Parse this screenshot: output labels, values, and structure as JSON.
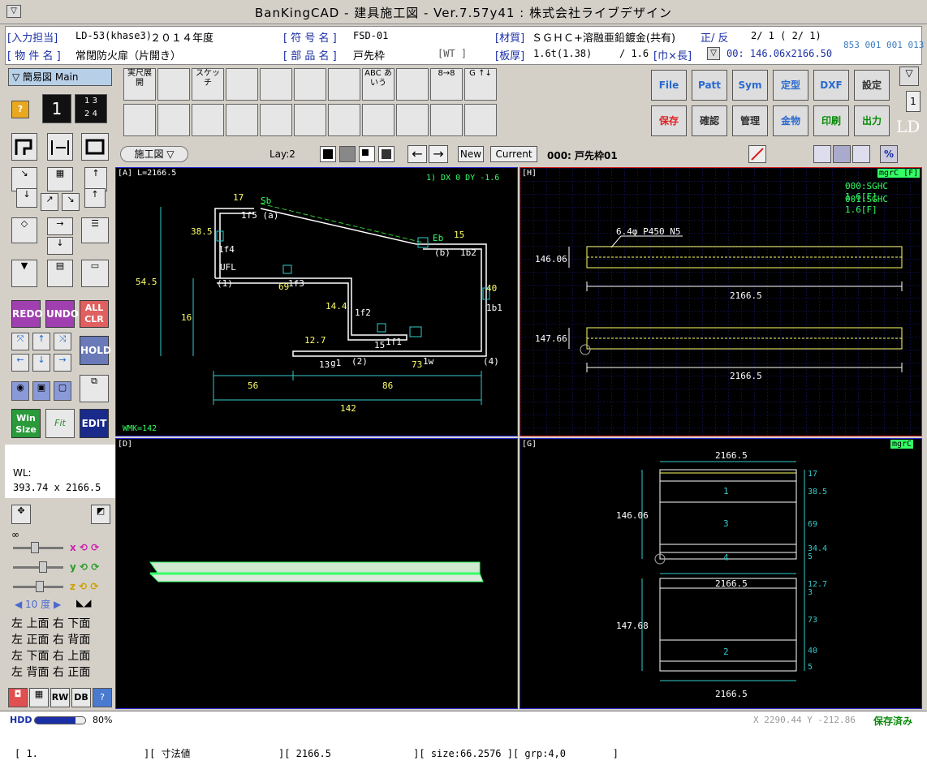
{
  "app": {
    "title": "BanKingCAD - 建具施工図 - Ver.7.57y41 : 株式会社ライブデザイン"
  },
  "info": {
    "nyuryoku_label": "[入力担当]",
    "nyuryoku_value": "LD-53(khase3)",
    "year": "２０１４年度",
    "fugo_label": "[ 符 号 名 ]",
    "fugo_value": "FSD-01",
    "zaishitsu_label": "[材質]",
    "zaishitsu_value": "ＳＧＨＣ+溶融亜鉛鍍金(共有)",
    "seihan": "正/ 反",
    "page": "2/ 1 ( 2/ 1)",
    "codes": "853 001 001 013",
    "bukken_label": "[ 物 件 名 ]",
    "bukken_value": "常閉防火扉（片開き）",
    "buhin_label": "[ 部 品 名 ]",
    "buhin_value": "戸先枠",
    "wt": "[WT  ]",
    "itaatsu_label": "[板厚]",
    "itaatsu_value": "1.6t(1.38)",
    "itaatsu2": "/ 1.6",
    "haba_label": "[巾×長]",
    "haba_value": "00: 146.06x2166.50"
  },
  "left": {
    "mode": "簡易図 Main",
    "num": "1",
    "grid": [
      "1",
      "3",
      "2",
      "4"
    ],
    "redo": "REDO",
    "undo": "UNDO",
    "allclr": "ALL CLR",
    "hold": "HOLD",
    "win": "Win Size",
    "edit": "EDIT",
    "wl_label": "WL:",
    "wl_value": "393.74 x 2166.5",
    "inf": "∞",
    "deg": "10 度",
    "views": [
      [
        "左",
        "上面",
        "右",
        "下面"
      ],
      [
        "左",
        "正面",
        "右",
        "背面"
      ],
      [
        "左",
        "下面",
        "右",
        "上面"
      ],
      [
        "左",
        "背面",
        "右",
        "正面"
      ]
    ],
    "bottom": [
      "RW",
      "DB"
    ]
  },
  "toolbar": {
    "tools": [
      "実尺展開",
      "",
      "スケッチ",
      "",
      "",
      "",
      "",
      "ABC あいう",
      "",
      "8→8",
      "G ↑↓",
      "",
      "",
      "",
      "",
      "",
      "",
      "",
      "",
      "",
      "",
      ""
    ],
    "file_buttons": [
      "File",
      "Patt",
      "Sym",
      "定型",
      "DXF",
      "設定",
      "保存",
      "確認",
      "管理",
      "金物",
      "印刷",
      "出力"
    ],
    "ld": "LD",
    "side_num": "1"
  },
  "toolbar2": {
    "view": "施工図 ▽",
    "lay": "Lay:2",
    "new": "New",
    "current": "Current",
    "part": "000: 戸先枠01"
  },
  "paneA": {
    "label": "[A]  L=2166.5",
    "dx": "1) DX    0 DY -1.6",
    "wmk": "WMK=142",
    "dims": [
      "17",
      "38.5",
      "15",
      "54.5",
      "16",
      "14.4",
      "12.7",
      "40",
      "73",
      "56",
      "86",
      "142",
      "69"
    ],
    "marks": [
      "Sb",
      "Eb",
      "1f5 (a)",
      "1f4",
      "(b)",
      "1b2",
      "UFL",
      "(1)",
      "1f3",
      "1f2",
      "1f1",
      "1b1",
      "(2)",
      "(4)",
      "1w",
      "g1",
      "15",
      "13"
    ]
  },
  "paneH": {
    "label": "[H]",
    "badge": "mgrC [F]",
    "line1": "000:SGHC 1.6[F]",
    "line2": "001:SGHC 1.6[F]",
    "d1": "146.06",
    "d2": "147.66",
    "len1": "2166.5",
    "len2": "2166.5",
    "hole": "6.4φ P450 N5"
  },
  "paneD": {
    "label": "[D]"
  },
  "paneG": {
    "label": "[G]",
    "badge": "mgrC",
    "top": "2166.5",
    "mid": "2166.5",
    "bot": "2166.5",
    "h1": "146.06",
    "h2": "147.68",
    "n1": "1",
    "n3": "3",
    "n4": "4",
    "n2": "2",
    "r": [
      "17",
      "38.5",
      "69",
      "34.4",
      "5",
      "12.7",
      "3",
      "73",
      "40",
      "5"
    ]
  },
  "status": {
    "hdd": "HDD",
    "pct": "80%",
    "coords": "X 2290.44 Y -212.86",
    "saved": "保存済み"
  },
  "bottom": "[ 1.                  ][ 寸法値               ][ 2166.5              ][ size:66.2576 ][ grp:4,0        ]",
  "colors": {
    "accent": "#1a2ea6",
    "cad_yellow": "#ffff66",
    "cad_cyan": "#33cccc",
    "cad_green": "#33ff66",
    "saved": "#0a8a0a"
  }
}
